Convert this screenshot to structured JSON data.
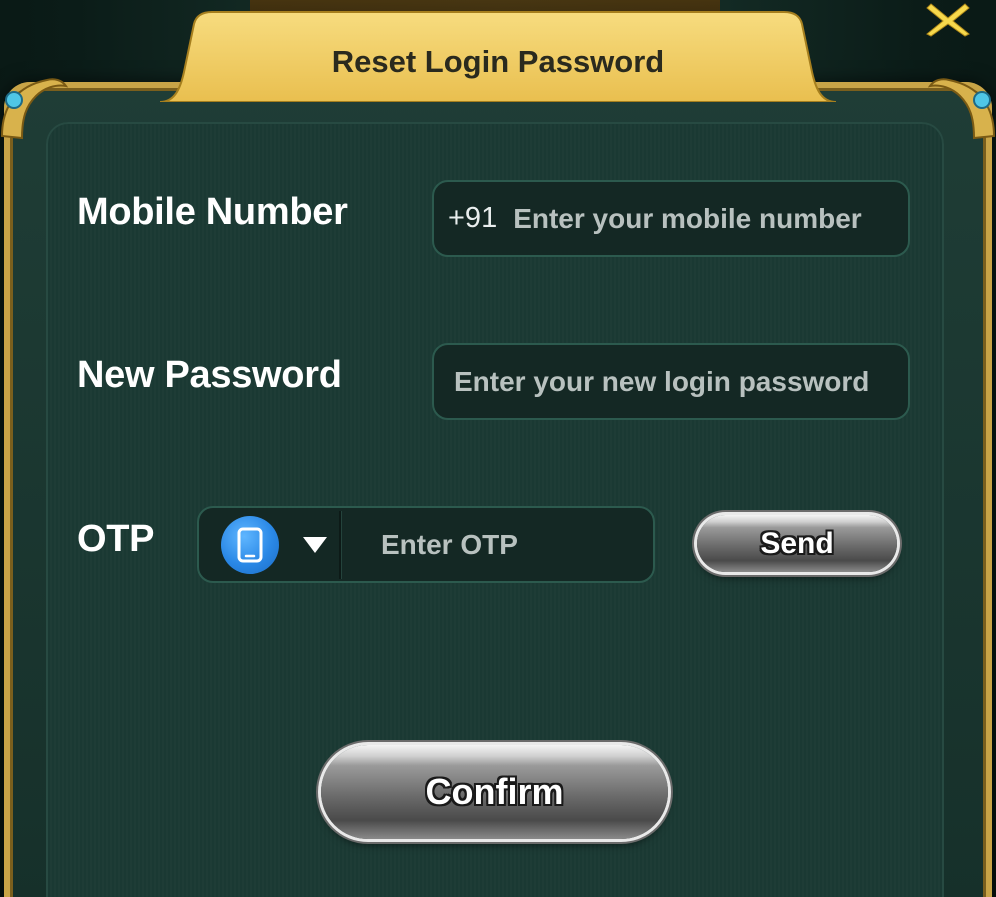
{
  "dialog": {
    "title": "Reset Login Password",
    "close_icon": "close-x-icon"
  },
  "form": {
    "mobile": {
      "label": "Mobile Number",
      "prefix": "+91",
      "placeholder": "Enter your mobile number",
      "value": ""
    },
    "new_password": {
      "label": "New Password",
      "placeholder": "Enter your new login password",
      "value": ""
    },
    "otp": {
      "label": "OTP",
      "method_icon": "phone-icon",
      "placeholder": "Enter OTP",
      "value": "",
      "send_label": "Send"
    },
    "confirm_label": "Confirm"
  },
  "colors": {
    "title_tab": "#f3cf6a",
    "panel_bg": "#1b3a34",
    "frame_gold": "#c8a447",
    "close_icon": "#f7d94c",
    "phone_badge": "#2a88e6"
  }
}
